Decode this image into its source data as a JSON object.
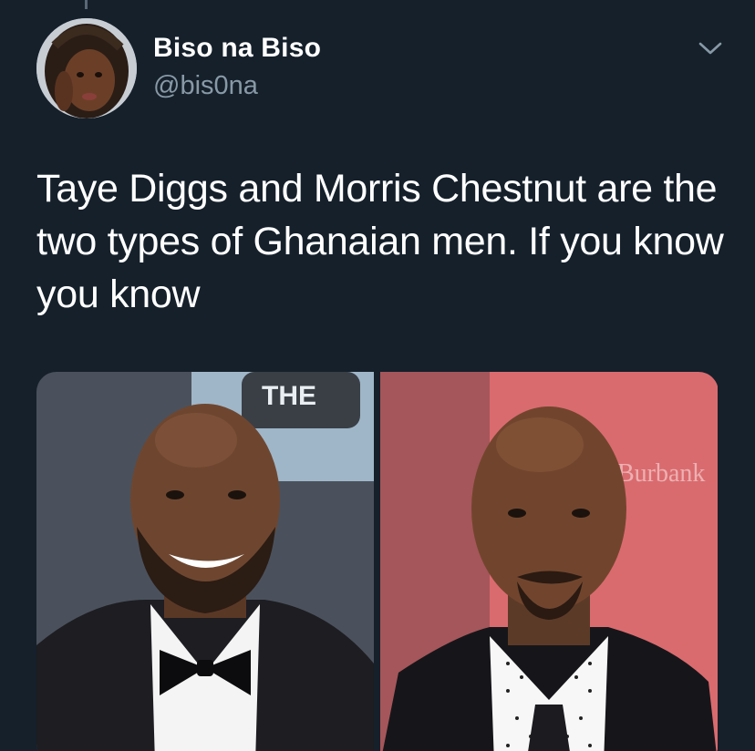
{
  "author": {
    "display_name": "Biso na Biso",
    "handle": "@bis0na"
  },
  "tweet": {
    "text": "Taye Diggs and Morris Chestnut are the two types of Ghanaian men. If you know you know"
  },
  "media": {
    "photos": [
      {
        "backdrop_sign_text": "THE"
      },
      {
        "backdrop_text": "Burbank"
      }
    ]
  },
  "icons": {
    "menu": "chevron-down-icon"
  },
  "colors": {
    "background": "#15202b",
    "text_primary": "#ffffff",
    "text_secondary": "#8899a6"
  }
}
